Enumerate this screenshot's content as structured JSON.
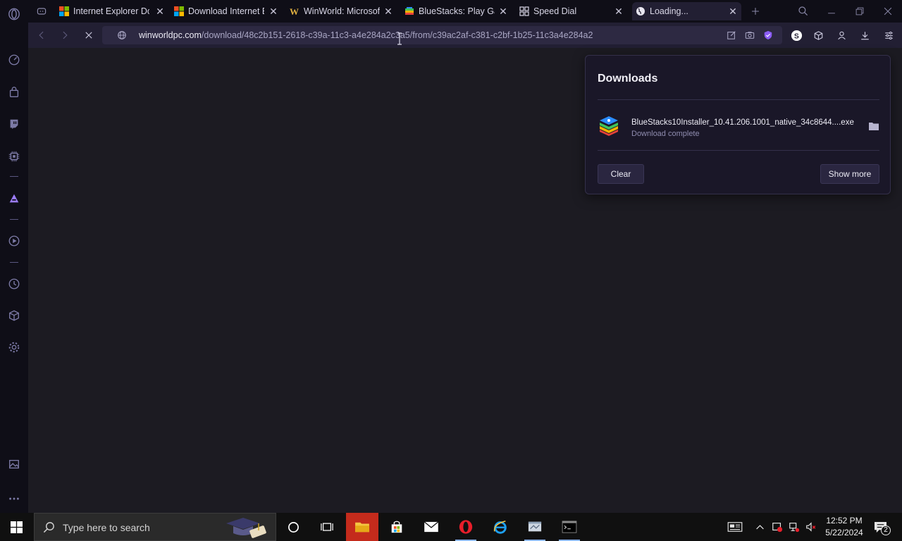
{
  "browser": {
    "tabs": [
      {
        "title": "Internet Explorer Do",
        "favicon": "microsoft-logo"
      },
      {
        "title": "Download Internet E",
        "favicon": "microsoft-logo"
      },
      {
        "title": "WinWorld: Microsoft",
        "favicon": "winworld-logo"
      },
      {
        "title": "BlueStacks: Play Gam",
        "favicon": "bluestacks-logo"
      },
      {
        "title": "Speed Dial",
        "favicon": "speed-dial-grid-icon"
      },
      {
        "title": "Loading...",
        "favicon": "globe-icon",
        "active": true
      }
    ],
    "url_host": "winworldpc.com",
    "url_path": "/download/48c2b151-2618-c39a-11c3-a4e284a2c3a5/from/c39ac2af-c381-c2bf-1b25-11c3a4e284a2",
    "accent_color": "#8b5cf6"
  },
  "downloads": {
    "title": "Downloads",
    "items": [
      {
        "filename": "BlueStacks10Installer_10.41.206.1001_native_34c8644....exe",
        "status": "Download complete"
      }
    ],
    "clear_label": "Clear",
    "show_more_label": "Show more"
  },
  "taskbar": {
    "search_placeholder": "Type here to search",
    "time": "12:52 PM",
    "date": "5/22/2024",
    "notification_count": "2"
  }
}
